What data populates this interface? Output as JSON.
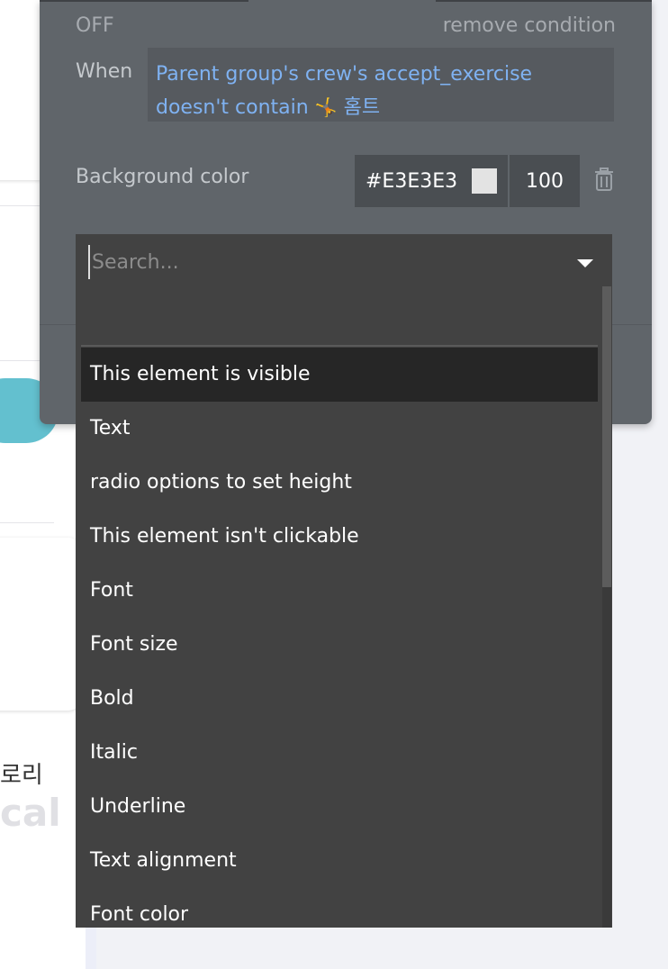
{
  "background": {
    "korean_fragment": "로리",
    "cal_fragment": "cal"
  },
  "condition": {
    "state_label": "OFF",
    "remove_label": "remove condition",
    "when_label": "When",
    "expression_line1": "Parent group's crew's accept_exercise",
    "expression_line2_prefix": "doesn't contain",
    "expression_emoji": "🤸",
    "expression_line2_suffix": "홈트",
    "property_label": "Background color",
    "color_hex": "#E3E3E3",
    "opacity": "100"
  },
  "dropdown": {
    "search_placeholder": "Search...",
    "options": [
      "This element is visible",
      "Text",
      "radio options to set height",
      "This element isn't clickable",
      "Font",
      "Font size",
      "Bold",
      "Italic",
      "Underline",
      "Text alignment",
      "Font color"
    ],
    "highlighted_index": 0
  },
  "colors": {
    "panel_bg": "#60656a",
    "dropdown_bg": "#424242",
    "expression_text": "#7fb2f2",
    "accent_pill": "#63c0cf",
    "swatch": "#E3E3E3"
  }
}
